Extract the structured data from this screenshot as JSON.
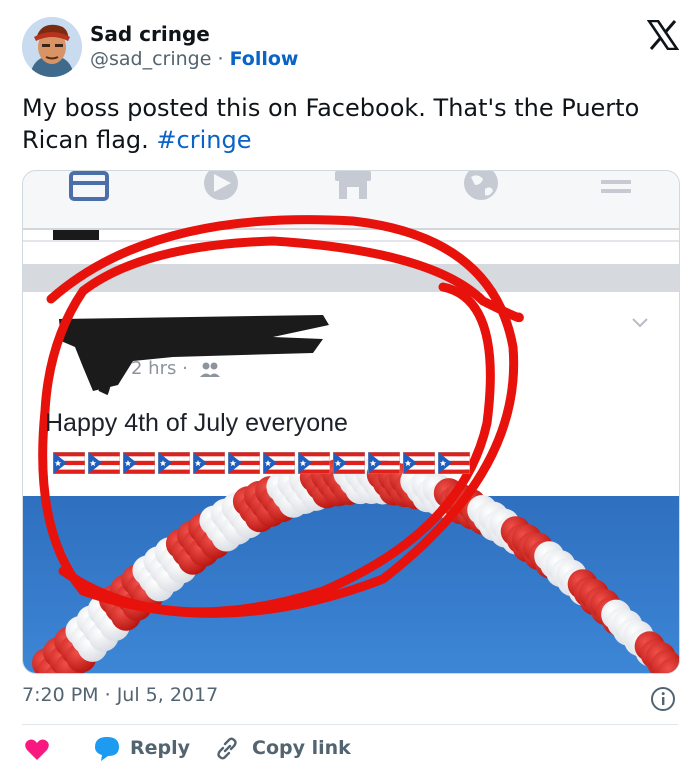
{
  "author": {
    "display_name": "Sad cringe",
    "handle": "@sad_cringe",
    "separator": "·",
    "follow_label": "Follow"
  },
  "tweet": {
    "text": "My boss posted this on Facebook. That's the Puerto Rican flag. ",
    "hashtag": "#cringe"
  },
  "fb_post": {
    "time_ago": "2 hrs",
    "separator": "·",
    "message": "Happy 4th of July everyone",
    "flag_count": 12
  },
  "meta": {
    "time": "7:20 PM",
    "separator": "·",
    "date": "Jul 5, 2017"
  },
  "actions": {
    "reply_label": "Reply",
    "copy_link_label": "Copy link"
  },
  "colors": {
    "link_blue": "#0a63c6",
    "like_pink": "#f91880",
    "reply_blue": "#1d9bf0",
    "annotation_red": "#e8120c"
  }
}
